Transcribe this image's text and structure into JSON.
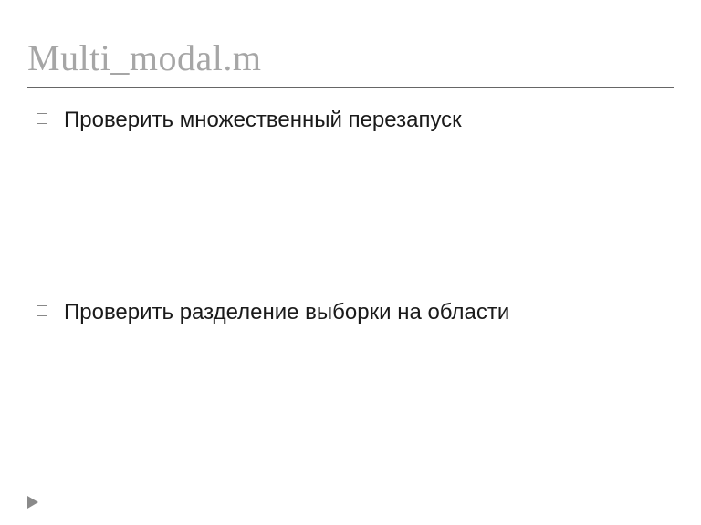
{
  "title": "Multi_modal.m",
  "bullets": [
    {
      "text": "Проверить множественный перезапуск"
    },
    {
      "text": "Проверить разделение выборки на области"
    }
  ]
}
